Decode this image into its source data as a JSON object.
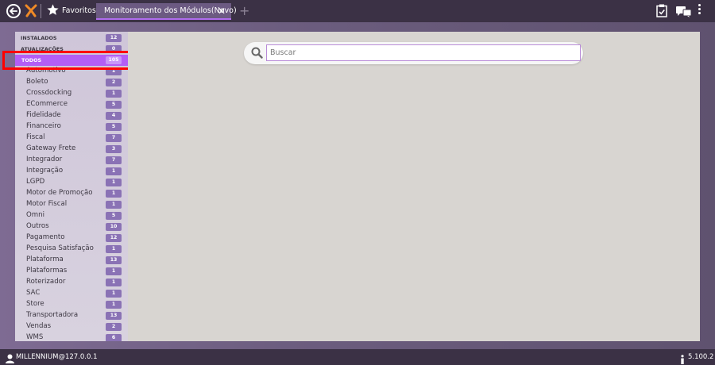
{
  "topbar": {
    "favorites_label": "Favoritos -",
    "active_tab": {
      "label": "Monitoramento dos Módulos(Novo)",
      "close": "✕"
    },
    "new_tab": "+"
  },
  "sidebar": {
    "items": [
      {
        "label": "INSTALADOS",
        "count": "12",
        "type": "header"
      },
      {
        "label": "ATUALIZAÇÕES",
        "count": "0",
        "type": "header"
      },
      {
        "label": "TODOS",
        "count": "105",
        "type": "header",
        "selected": true
      },
      {
        "label": "Automotivo",
        "count": "1"
      },
      {
        "label": "Boleto",
        "count": "2"
      },
      {
        "label": "Crossdocking",
        "count": "1"
      },
      {
        "label": "ECommerce",
        "count": "5"
      },
      {
        "label": "Fidelidade",
        "count": "4"
      },
      {
        "label": "Financeiro",
        "count": "5"
      },
      {
        "label": "Fiscal",
        "count": "7"
      },
      {
        "label": "Gateway Frete",
        "count": "3"
      },
      {
        "label": "Integrador",
        "count": "7"
      },
      {
        "label": "Integração",
        "count": "1"
      },
      {
        "label": "LGPD",
        "count": "1"
      },
      {
        "label": "Motor de Promoção",
        "count": "1"
      },
      {
        "label": "Motor Fiscal",
        "count": "1"
      },
      {
        "label": "Omni",
        "count": "5"
      },
      {
        "label": "Outros",
        "count": "10"
      },
      {
        "label": "Pagamento",
        "count": "12"
      },
      {
        "label": "Pesquisa Satisfação",
        "count": "1"
      },
      {
        "label": "Plataforma",
        "count": "13"
      },
      {
        "label": "Plataformas",
        "count": "1"
      },
      {
        "label": "Roterizador",
        "count": "1"
      },
      {
        "label": "SAC",
        "count": "1"
      },
      {
        "label": "Store",
        "count": "1"
      },
      {
        "label": "Transportadora",
        "count": "13"
      },
      {
        "label": "Vendas",
        "count": "2"
      },
      {
        "label": "WMS",
        "count": "6"
      }
    ]
  },
  "search": {
    "placeholder": "Buscar",
    "value": ""
  },
  "footer": {
    "user": "MILLENNIUM@127.0.0.1",
    "version": "5.100.2"
  },
  "colors": {
    "accent": "#b35ef5",
    "badge": "#8a72b5",
    "highlight": "#ff0000"
  }
}
